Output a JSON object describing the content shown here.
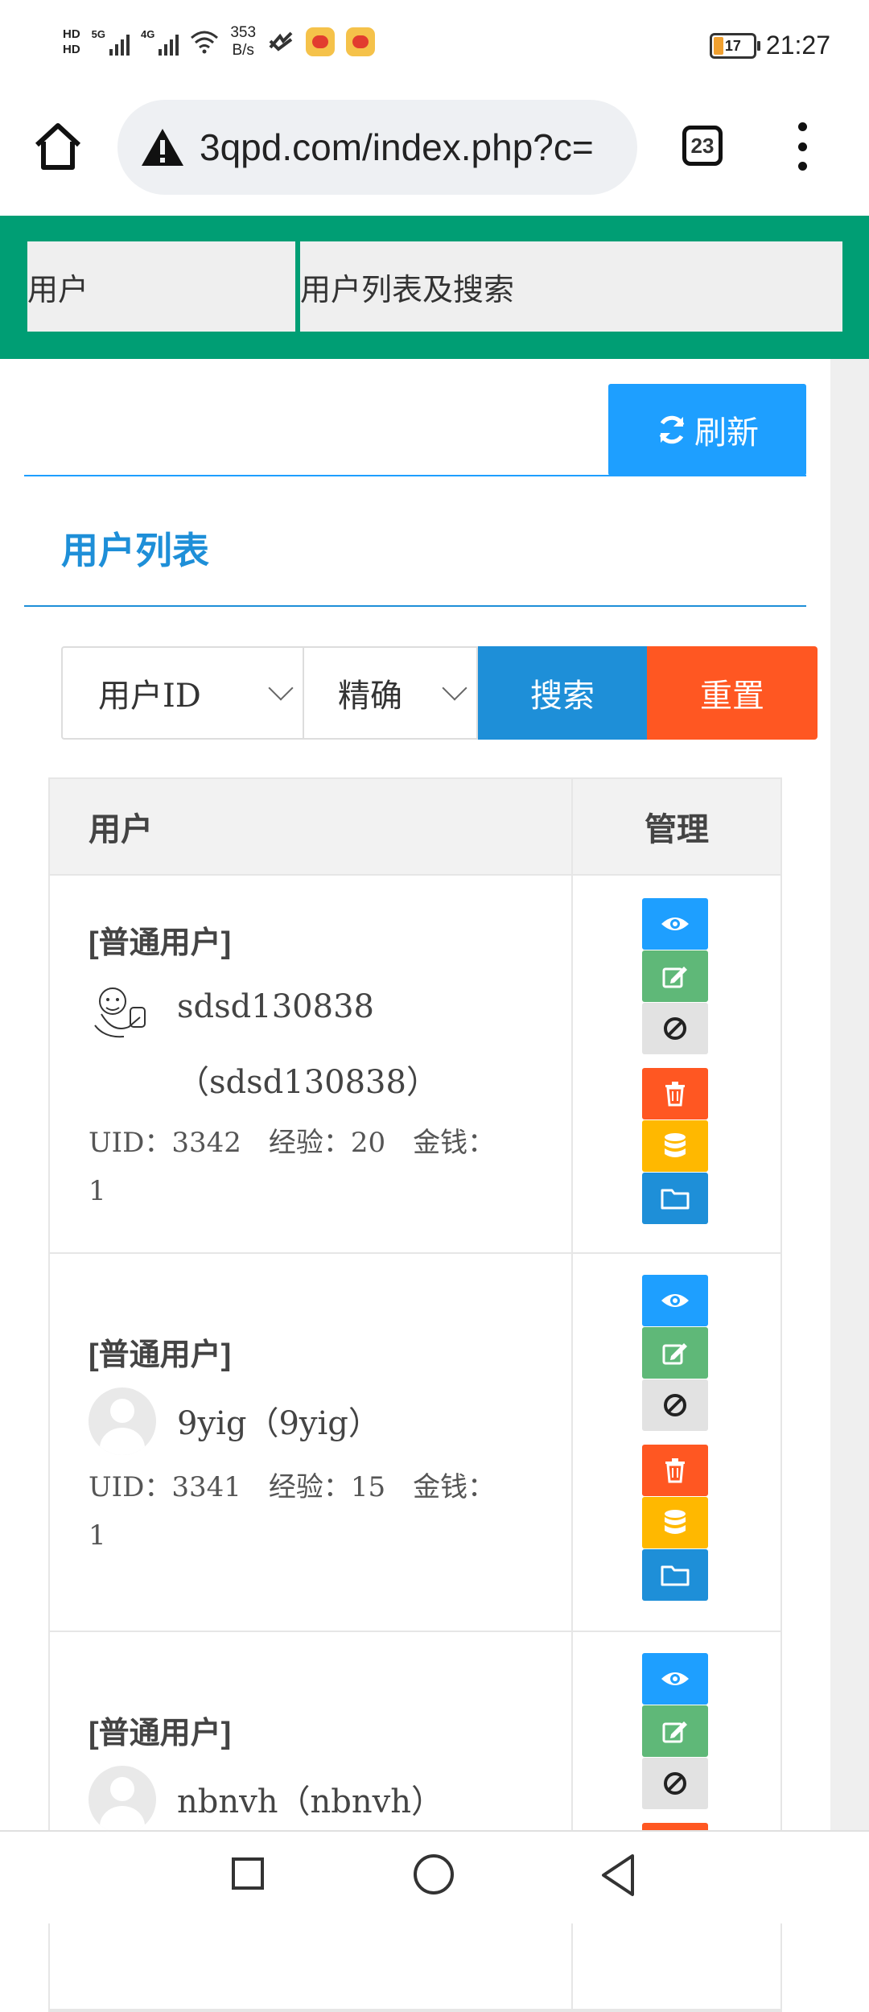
{
  "status_bar": {
    "hd1": "HD",
    "hd2": "HD",
    "net1": "5G",
    "net2": "4G",
    "speed_value": "353",
    "speed_unit": "B/s",
    "battery": "17",
    "time": "21:27"
  },
  "browser": {
    "url": "3qpd.com/index.php?c=",
    "tab_count": "23"
  },
  "breadcrumb": {
    "item1": "用户",
    "item2": "用户列表及搜索"
  },
  "toolbar": {
    "refresh_label": "刷新"
  },
  "section": {
    "title": "用户列表"
  },
  "search": {
    "field_select": "用户ID",
    "mode_select": "精确",
    "search_label": "搜索",
    "reset_label": "重置"
  },
  "table": {
    "headers": [
      "用户",
      "管理"
    ],
    "rows": [
      {
        "role": "[普通用户]",
        "username_line1": "sdsd130838",
        "username_line2": "（sdsd130838）",
        "meta_line1": "UID：3342　经验：20　金钱：",
        "meta_line2": "1"
      },
      {
        "role": "[普通用户]",
        "username_line1": "9yig（9yig）",
        "meta_line1": "UID：3341　经验：15　金钱：",
        "meta_line2": "1"
      },
      {
        "role": "[普通用户]",
        "username_line1": "nbnvh（nbnvh）"
      }
    ]
  },
  "colors": {
    "header_green": "#009e74",
    "primary_blue": "#1e9fff",
    "dark_blue": "#1e8fd8",
    "danger_orange": "#ff5722",
    "success_green": "#5fb878",
    "warning_yellow": "#ffb800"
  },
  "icons": {
    "view": "eye-icon",
    "edit": "edit-icon",
    "ban": "ban-icon",
    "delete": "trash-icon",
    "money": "database-icon",
    "files": "folder-icon"
  }
}
